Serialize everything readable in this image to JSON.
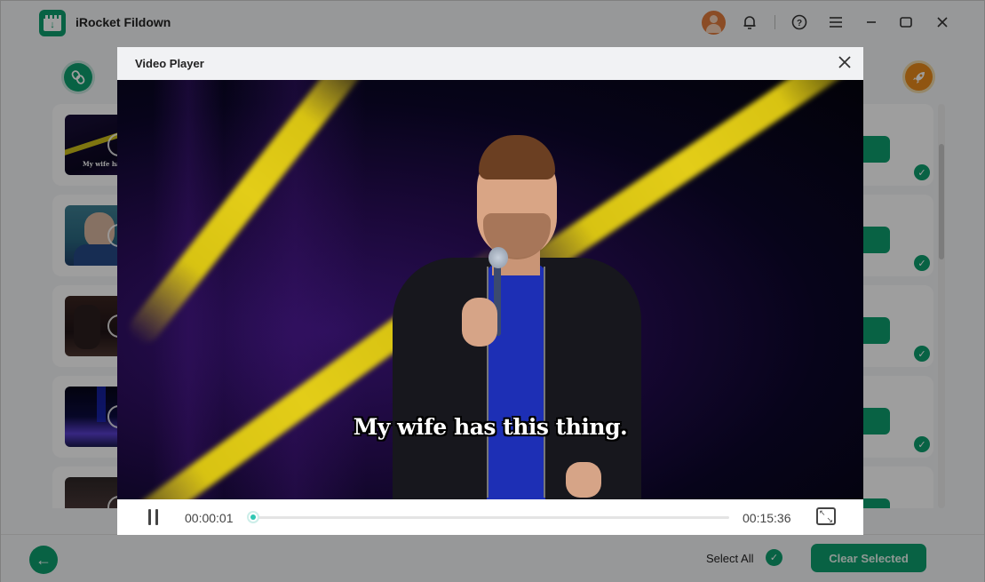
{
  "app": {
    "title": "iRocket Fildown",
    "logo_icon": "download-clapper-icon",
    "colors": {
      "brand": "#0e9f6e",
      "accent_orange": "#e88a1a",
      "progress": "#2fc7b3"
    }
  },
  "titlebar": {
    "icons": [
      "user-avatar-icon",
      "bell-icon",
      "help-icon",
      "menu-icon",
      "minimize-icon",
      "maximize-icon",
      "close-icon"
    ],
    "glyphs": {
      "bell": "🔔",
      "help": "?",
      "menu": "☰",
      "minimize": "—",
      "maximize": "☐",
      "close": "✕"
    }
  },
  "sidebar": {
    "left_button_icon": "link-icon",
    "right_button_icon": "rocket-icon"
  },
  "list": {
    "items": [
      {
        "thumb_caption": "My wife ha",
        "thumb_style": "stage",
        "selected": true
      },
      {
        "thumb_caption": "",
        "thumb_style": "morning",
        "selected": true
      },
      {
        "thumb_caption": "",
        "thumb_style": "friends",
        "selected": true
      },
      {
        "thumb_caption": "",
        "thumb_style": "concert",
        "selected": true
      },
      {
        "thumb_caption": "",
        "thumb_style": "room",
        "selected": true
      }
    ]
  },
  "footer": {
    "back_glyph": "←",
    "select_all_label": "Select All",
    "select_all_checked": true,
    "clear_selected_label": "Clear Selected",
    "check_glyph": "✓"
  },
  "video_player": {
    "title": "Video Player",
    "close_glyph": "✕",
    "subtitle": "My wife has this thing.",
    "state": "playing",
    "current_time": "00:00:01",
    "total_time": "00:15:36",
    "progress_fraction": 0.001,
    "fullscreen_glyphs": [
      "↖",
      "↘"
    ]
  }
}
